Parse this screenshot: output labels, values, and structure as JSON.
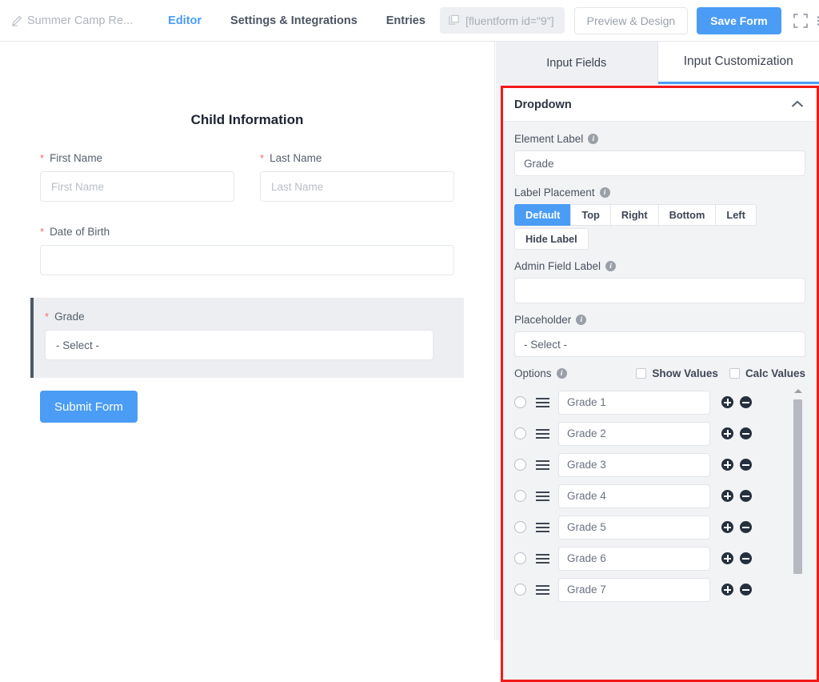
{
  "topbar": {
    "form_title": "Summer Camp Re...",
    "pencil_icon": "pencil-icon",
    "nav": [
      {
        "label": "Editor",
        "active": true
      },
      {
        "label": "Settings & Integrations",
        "active": false
      },
      {
        "label": "Entries",
        "active": false
      }
    ],
    "shortcode": "[fluentform id=\"9\"]",
    "copy_icon": "copy-icon",
    "preview_button": "Preview & Design",
    "save_button": "Save Form",
    "expand_icon": "expand-icon",
    "kebab_icon": "kebab-menu-icon",
    "accent_color": "#4a9cf5"
  },
  "preview": {
    "heading": "Child Information",
    "required_mark": "*",
    "fields": [
      {
        "label": "First Name",
        "placeholder": "First Name",
        "required": true
      },
      {
        "label": "Last Name",
        "placeholder": "Last Name",
        "required": true
      },
      {
        "label": "Date of Birth",
        "placeholder": "",
        "required": true
      }
    ],
    "selected_field": {
      "label": "Grade",
      "required": true,
      "value": "- Select -"
    },
    "submit_label": "Submit Form"
  },
  "panel": {
    "tabs": [
      {
        "label": "Input Fields",
        "active": false
      },
      {
        "label": "Input Customization",
        "active": true
      }
    ],
    "section_title": "Dropdown",
    "collapse_icon": "chevron-up-icon",
    "highlight_color": "#f41919",
    "element_label": {
      "label": "Element Label",
      "value": "Grade",
      "info_icon": "info-icon"
    },
    "label_placement": {
      "label": "Label Placement",
      "info_icon": "info-icon",
      "options": [
        "Default",
        "Top",
        "Right",
        "Bottom",
        "Left",
        "Hide Label"
      ],
      "selected": "Default"
    },
    "admin_field_label": {
      "label": "Admin Field Label",
      "value": "",
      "info_icon": "info-icon"
    },
    "placeholder_setting": {
      "label": "Placeholder",
      "value": "- Select -",
      "info_icon": "info-icon"
    },
    "options_section": {
      "label": "Options",
      "info_icon": "info-icon",
      "show_values": {
        "label": "Show Values",
        "checked": false
      },
      "calc_values": {
        "label": "Calc Values",
        "checked": false
      },
      "rows": [
        {
          "value": "Grade 1",
          "selected": false
        },
        {
          "value": "Grade 2",
          "selected": false
        },
        {
          "value": "Grade 3",
          "selected": false
        },
        {
          "value": "Grade 4",
          "selected": false
        },
        {
          "value": "Grade 5",
          "selected": false
        },
        {
          "value": "Grade 6",
          "selected": false
        },
        {
          "value": "Grade 7",
          "selected": false
        }
      ],
      "add_icon": "plus-circle-icon",
      "remove_icon": "minus-circle-icon",
      "drag_icon": "drag-handle-icon",
      "radio_icon": "radio-button-icon"
    }
  }
}
